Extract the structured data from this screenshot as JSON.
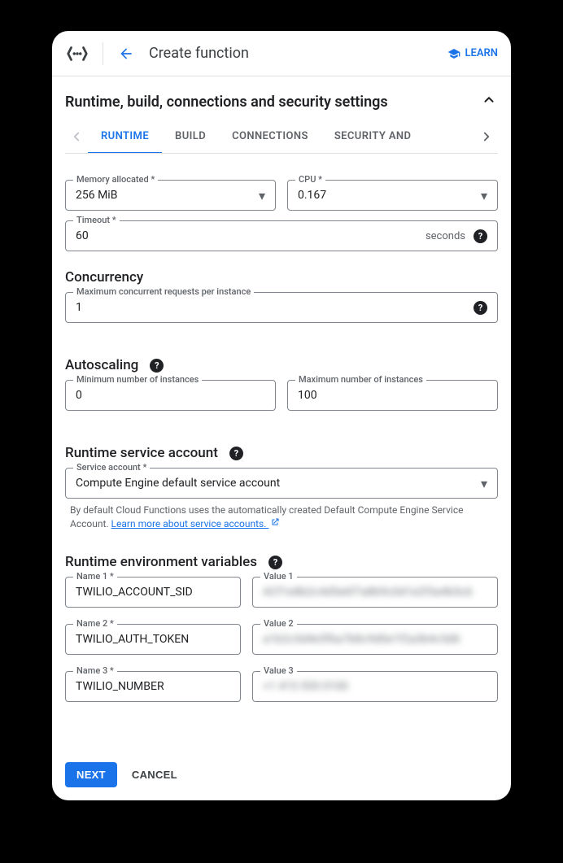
{
  "header": {
    "title": "Create function",
    "learn_label": "LEARN"
  },
  "section": {
    "title": "Runtime, build, connections and security settings"
  },
  "tabs": [
    "RUNTIME",
    "BUILD",
    "CONNECTIONS",
    "SECURITY AND"
  ],
  "runtime": {
    "memory_label": "Memory allocated *",
    "memory_value": "256 MiB",
    "cpu_label": "CPU *",
    "cpu_value": "0.167",
    "timeout_label": "Timeout *",
    "timeout_value": "60",
    "timeout_suffix": "seconds"
  },
  "concurrency": {
    "heading": "Concurrency",
    "max_req_label": "Maximum concurrent requests per instance",
    "max_req_value": "1"
  },
  "autoscaling": {
    "heading": "Autoscaling",
    "min_label": "Minimum number of instances",
    "min_value": "0",
    "max_label": "Maximum number of instances",
    "max_value": "100"
  },
  "service_account": {
    "heading": "Runtime service account",
    "label": "Service account *",
    "value": "Compute Engine default service account",
    "note_prefix": "By default Cloud Functions uses the automatically created Default Compute Engine Service Account. ",
    "note_link": "Learn more about service accounts."
  },
  "env": {
    "heading": "Runtime environment variables",
    "rows": [
      {
        "name_label": "Name 1 *",
        "name_value": "TWILIO_ACCOUNT_SID",
        "value_label": "Value 1",
        "value_value": "ACf1e8b2c4d5e6f7a8b9c0d1e2f3a4b5c6"
      },
      {
        "name_label": "Name 2 *",
        "name_value": "TWILIO_AUTH_TOKEN",
        "value_label": "Value 2",
        "value_value": "a1b2c3d4e5f6a7b8c9d0e1f2a3b4c5d6"
      },
      {
        "name_label": "Name 3 *",
        "name_value": "TWILIO_NUMBER",
        "value_label": "Value 3",
        "value_value": "+1 415 555 0100"
      }
    ]
  },
  "footer": {
    "next": "NEXT",
    "cancel": "CANCEL"
  }
}
